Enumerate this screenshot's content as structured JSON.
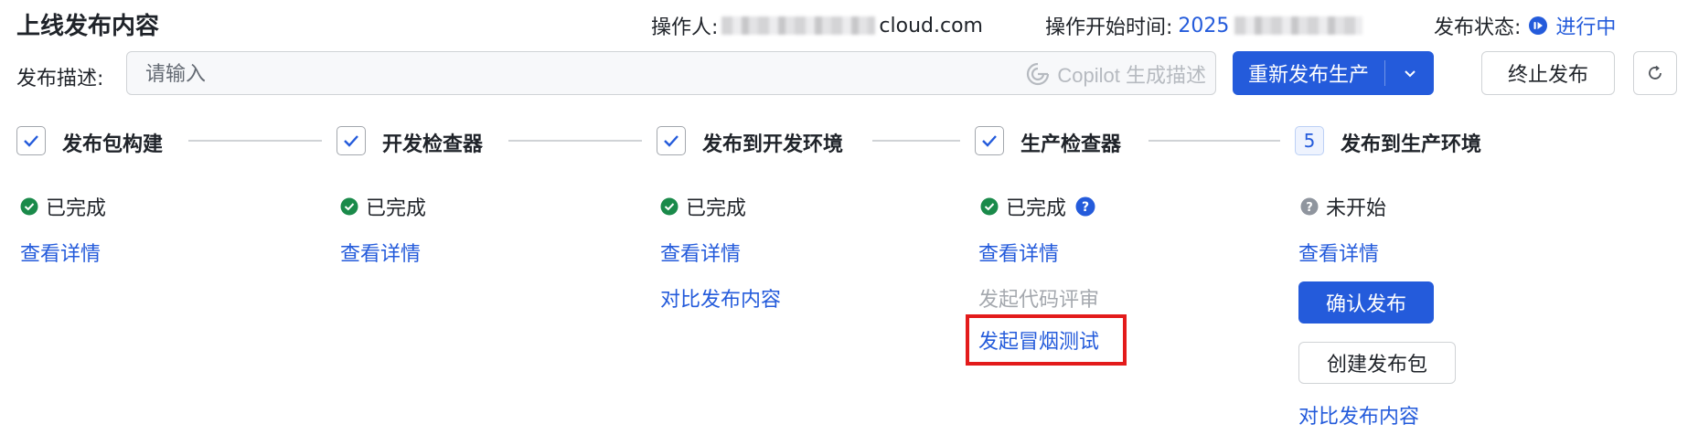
{
  "header": {
    "title": "上线发布内容",
    "operator_label": "操作人:",
    "operator_value_suffix": "cloud.com",
    "start_time_label": "操作开始时间:",
    "start_time_value_prefix": "2025",
    "status_label": "发布状态:",
    "status_value": "进行中"
  },
  "description": {
    "label": "发布描述:",
    "placeholder": "请输入",
    "copilot_label": "Copilot 生成描述"
  },
  "actions": {
    "republish_label": "重新发布生产",
    "terminate_label": "终止发布"
  },
  "steps": [
    {
      "label": "发布包构建",
      "state": "done",
      "status": "已完成",
      "links": [
        "查看详情"
      ]
    },
    {
      "label": "开发检查器",
      "state": "done",
      "status": "已完成",
      "links": [
        "查看详情"
      ]
    },
    {
      "label": "发布到开发环境",
      "state": "done",
      "status": "已完成",
      "links": [
        "查看详情",
        "对比发布内容"
      ]
    },
    {
      "label": "生产检查器",
      "state": "done",
      "status": "已完成",
      "links": [
        "查看详情"
      ],
      "disabled_link": "发起代码评审",
      "highlighted_link": "发起冒烟测试"
    },
    {
      "label": "发布到生产环境",
      "number": "5",
      "state": "pending",
      "status": "未开始",
      "links": [
        "查看详情"
      ],
      "primary_button": "确认发布",
      "secondary_button": "创建发布包",
      "extra_link": "对比发布内容"
    }
  ],
  "colors": {
    "accent": "#245bdb",
    "success": "#1a8a4a",
    "pending": "#8f959e",
    "highlight": "#e31b1b"
  }
}
